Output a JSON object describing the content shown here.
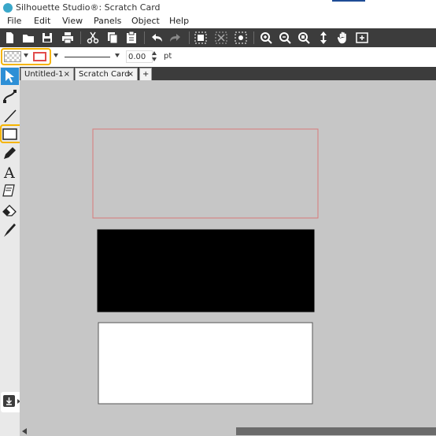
{
  "app": {
    "window_title": "Silhouette Studio®: Scratch Card"
  },
  "menu": {
    "items": [
      "File",
      "Edit",
      "View",
      "Panels",
      "Object",
      "Help"
    ]
  },
  "toolbar": {
    "icons": [
      "new-document-icon",
      "open-folder-icon",
      "save-icon",
      "print-icon",
      "cut-icon",
      "copy-icon",
      "paste-icon",
      "undo-icon",
      "redo-icon",
      "group-icon",
      "ungroup-icon",
      "replicate-icon",
      "zoom-in-icon",
      "zoom-out-icon",
      "zoom-to-fit-icon",
      "move-icon",
      "pan-hand-icon",
      "add-page-icon"
    ]
  },
  "properties": {
    "line_weight_value": "0.00",
    "line_weight_unit": "pt",
    "colors": {
      "stroke_swatch": "#e24c4c",
      "highlight": "#f5b400"
    }
  },
  "tabs": [
    {
      "label": "Untitled-1",
      "close": "×"
    },
    {
      "label": "Scratch Card",
      "close": "×"
    }
  ],
  "tab_add_label": "+",
  "left_tools": [
    "select-arrow-icon",
    "edit-points-icon",
    "line-tool-icon",
    "rectangle-tool-icon",
    "pencil-tool-icon",
    "text-tool-icon",
    "eraser-paper-icon",
    "eraser-tool-icon",
    "knife-tool-icon"
  ],
  "canvas": {
    "shapes": [
      {
        "name": "outlined-rectangle",
        "fill": "none",
        "stroke": "#d87a7a"
      },
      {
        "name": "black-rectangle",
        "fill": "#000000",
        "stroke": "#000000"
      },
      {
        "name": "white-rectangle",
        "fill": "#ffffff",
        "stroke": "#555555"
      }
    ]
  }
}
